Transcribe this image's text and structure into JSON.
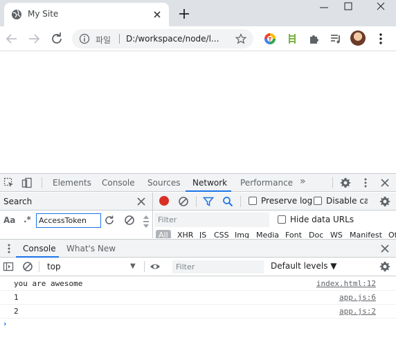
{
  "browser": {
    "tab_title": "My Site",
    "omnibox_scheme": "파일",
    "omnibox_url": "D:/workspace/node/l..."
  },
  "devtools": {
    "tabs": [
      "Elements",
      "Console",
      "Sources",
      "Network",
      "Performance"
    ],
    "active_tab": "Network",
    "more_tabs": "»",
    "search": {
      "title": "Search",
      "case_toggle": "Aa",
      "regex_toggle": ".*",
      "query": "AccessToken"
    },
    "network": {
      "preserve_log_label": "Preserve log",
      "disable_cache_label": "Disable cac",
      "filter_placeholder": "Filter",
      "hide_data_urls_label": "Hide data URLs",
      "type_filters": [
        "All",
        "XHR",
        "JS",
        "CSS",
        "Img",
        "Media",
        "Font",
        "Doc",
        "WS",
        "Manifest",
        "Ot"
      ]
    },
    "drawer": {
      "tabs": [
        "Console",
        "What's New"
      ],
      "active_tab": "Console"
    },
    "console": {
      "context": "top",
      "filter_placeholder": "Filter",
      "levels_label": "Default levels ▼",
      "messages": [
        {
          "text": "you are awesome",
          "source": "index.html:12"
        },
        {
          "text": "1",
          "source": "app.js:6"
        },
        {
          "text": "2",
          "source": "app.js:2"
        }
      ],
      "prompt": "›"
    }
  },
  "colors": {
    "accent": "#1a73e8",
    "record": "#d93025",
    "tabstrip": "#dee1e6",
    "toolbar_gray": "#f1f3f4"
  }
}
